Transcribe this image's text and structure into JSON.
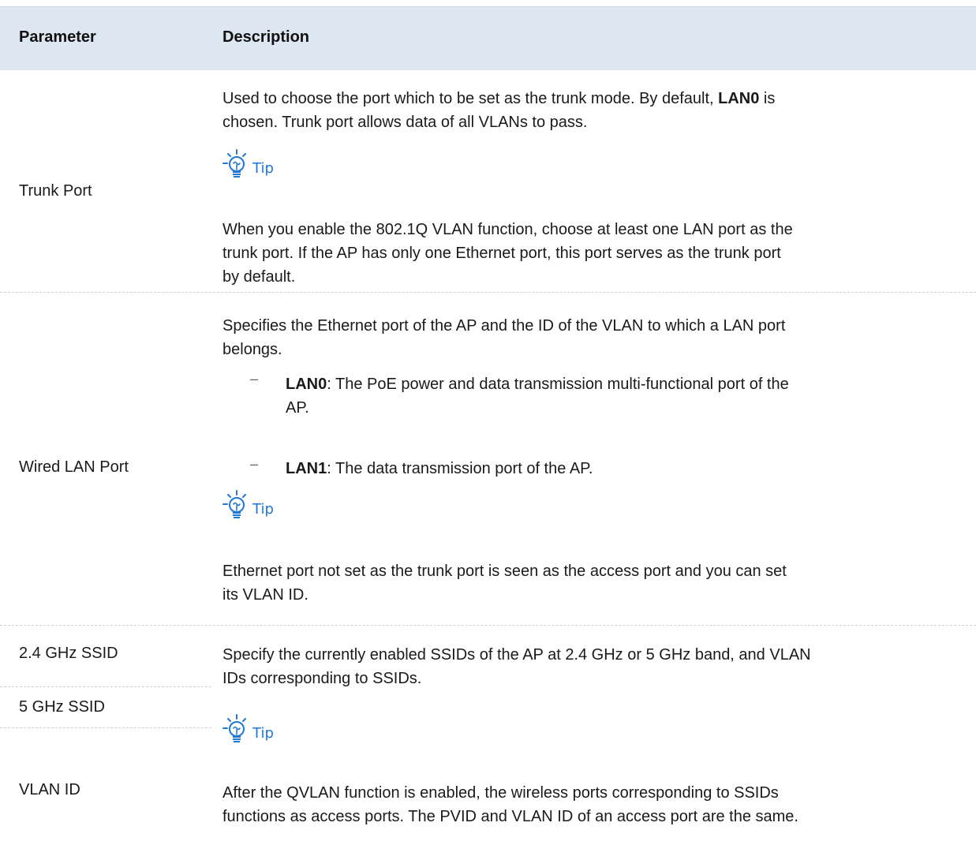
{
  "header": {
    "parameter": "Parameter",
    "description": "Description"
  },
  "tip_label": "Tip",
  "rows": {
    "trunk": {
      "param": "Trunk Port",
      "desc1_a": "Used to choose the port which to be set as the trunk mode. By default, ",
      "desc1_b": "LAN0",
      "desc1_c": " is",
      "desc1_line2": "chosen. Trunk port allows data of all VLANs to pass.",
      "tip_l1": "When you enable the 802.1Q VLAN function, choose at least one LAN port as the",
      "tip_l2": "trunk port. If the AP has only one Ethernet port, this port serves as the trunk port",
      "tip_l3": "by default."
    },
    "wired": {
      "param": "Wired LAN Port",
      "desc_l1": "Specifies the Ethernet port of the AP and the ID of the VLAN to which a LAN port",
      "desc_l2": "belongs.",
      "bullet_dash": "–",
      "lan0_label": "LAN0",
      "lan0_text_l1": ": The PoE power and data transmission multi-functional port of the",
      "lan0_text_l2": "AP.",
      "lan1_label": "LAN1",
      "lan1_text": ": The data transmission port of the AP.",
      "tip_l1": "Ethernet port not set as the trunk port is seen as the access port and you can set",
      "tip_l2": "its VLAN ID."
    },
    "ssid": {
      "param_24": "2.4 GHz SSID",
      "param_5": "5 GHz SSID",
      "param_vlan": "VLAN ID",
      "desc_l1": "Specify the currently enabled SSIDs of the AP at 2.4 GHz or 5 GHz band, and VLAN",
      "desc_l2": "IDs corresponding to SSIDs.",
      "tip_l1": "After the QVLAN function is enabled, the wireless ports corresponding to SSIDs",
      "tip_l2": "functions as access ports. The PVID and VLAN ID of an access port are the same."
    }
  },
  "colors": {
    "header_bg": "#dde7f1",
    "tip_blue": "#1f78d6"
  },
  "icons": {
    "tip": "lightbulb-tip-icon"
  }
}
